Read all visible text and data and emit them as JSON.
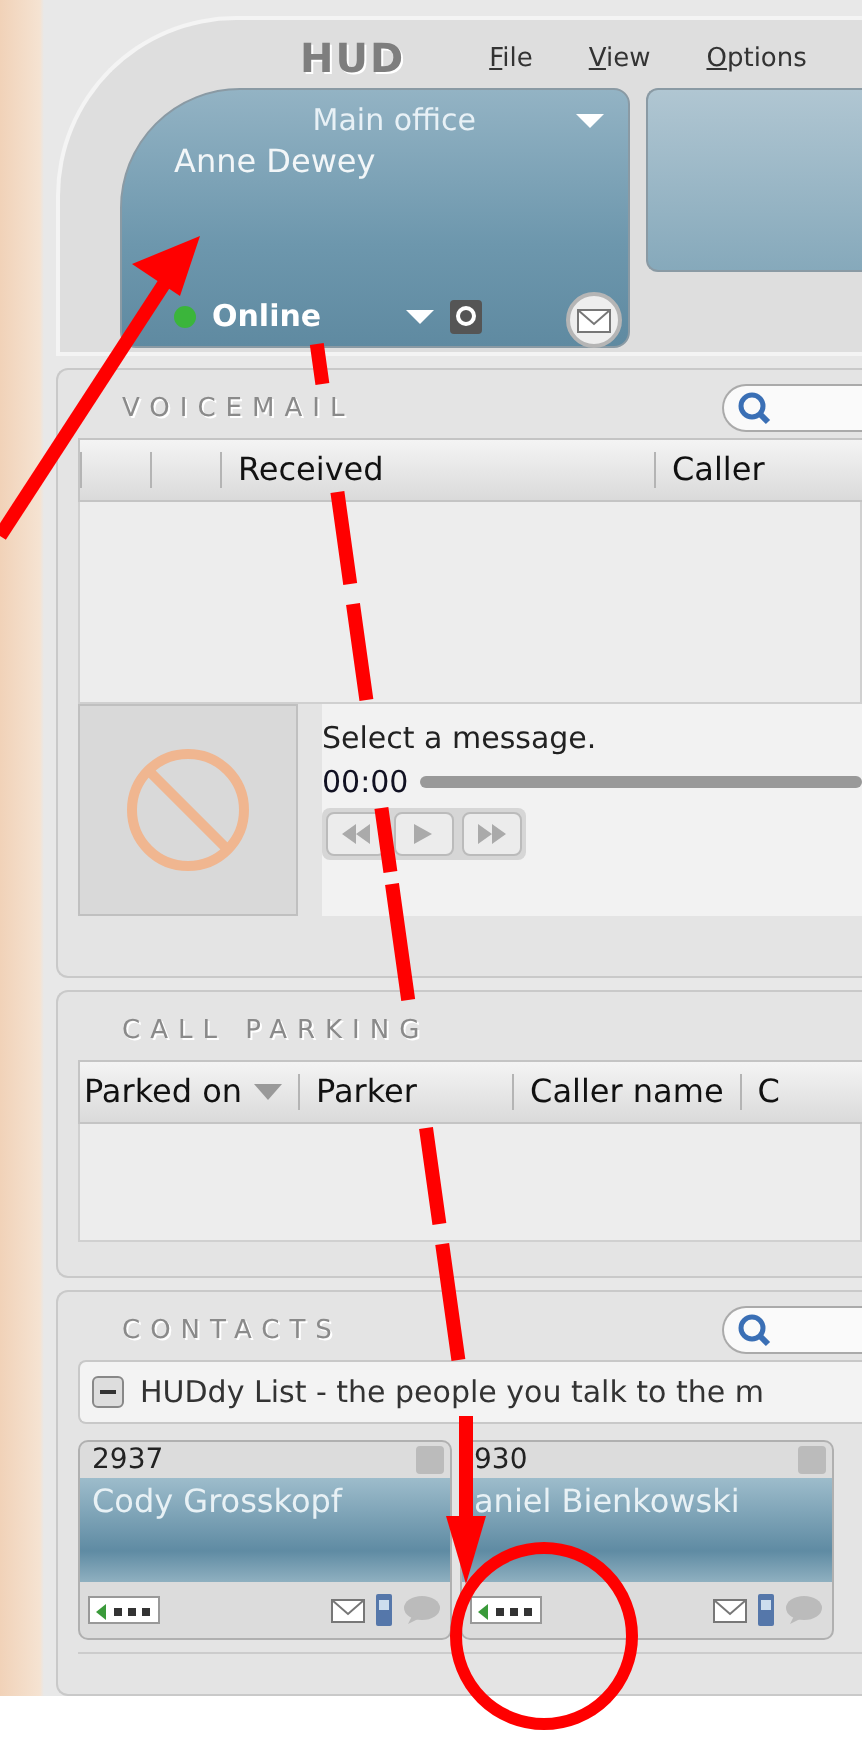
{
  "app": {
    "logo": "HUD",
    "menu": [
      {
        "label": "File"
      },
      {
        "label": "View"
      },
      {
        "label": "Options"
      }
    ]
  },
  "user_card": {
    "location": "Main office",
    "name": "Anne Dewey",
    "presence": "Online"
  },
  "voicemail": {
    "title": "VOICEMAIL",
    "columns": [
      "Received",
      "Caller"
    ],
    "player": {
      "prompt": "Select a message.",
      "time": "00:00"
    }
  },
  "call_parking": {
    "title": "CALL PARKING",
    "columns": [
      {
        "label": "Parked on",
        "sorted": true
      },
      {
        "label": "Parker",
        "sorted": false
      },
      {
        "label": "Caller name",
        "sorted": false
      },
      {
        "label": "C",
        "sorted": false
      }
    ]
  },
  "contacts": {
    "title": "CONTACTS",
    "group": {
      "label": "HUDdy List - the people you talk to the m",
      "expanded": true
    },
    "cards": [
      {
        "extension": "2937",
        "name": "Cody Grosskopf"
      },
      {
        "extension": "930",
        "name": "aniel Bienkowski"
      }
    ]
  }
}
